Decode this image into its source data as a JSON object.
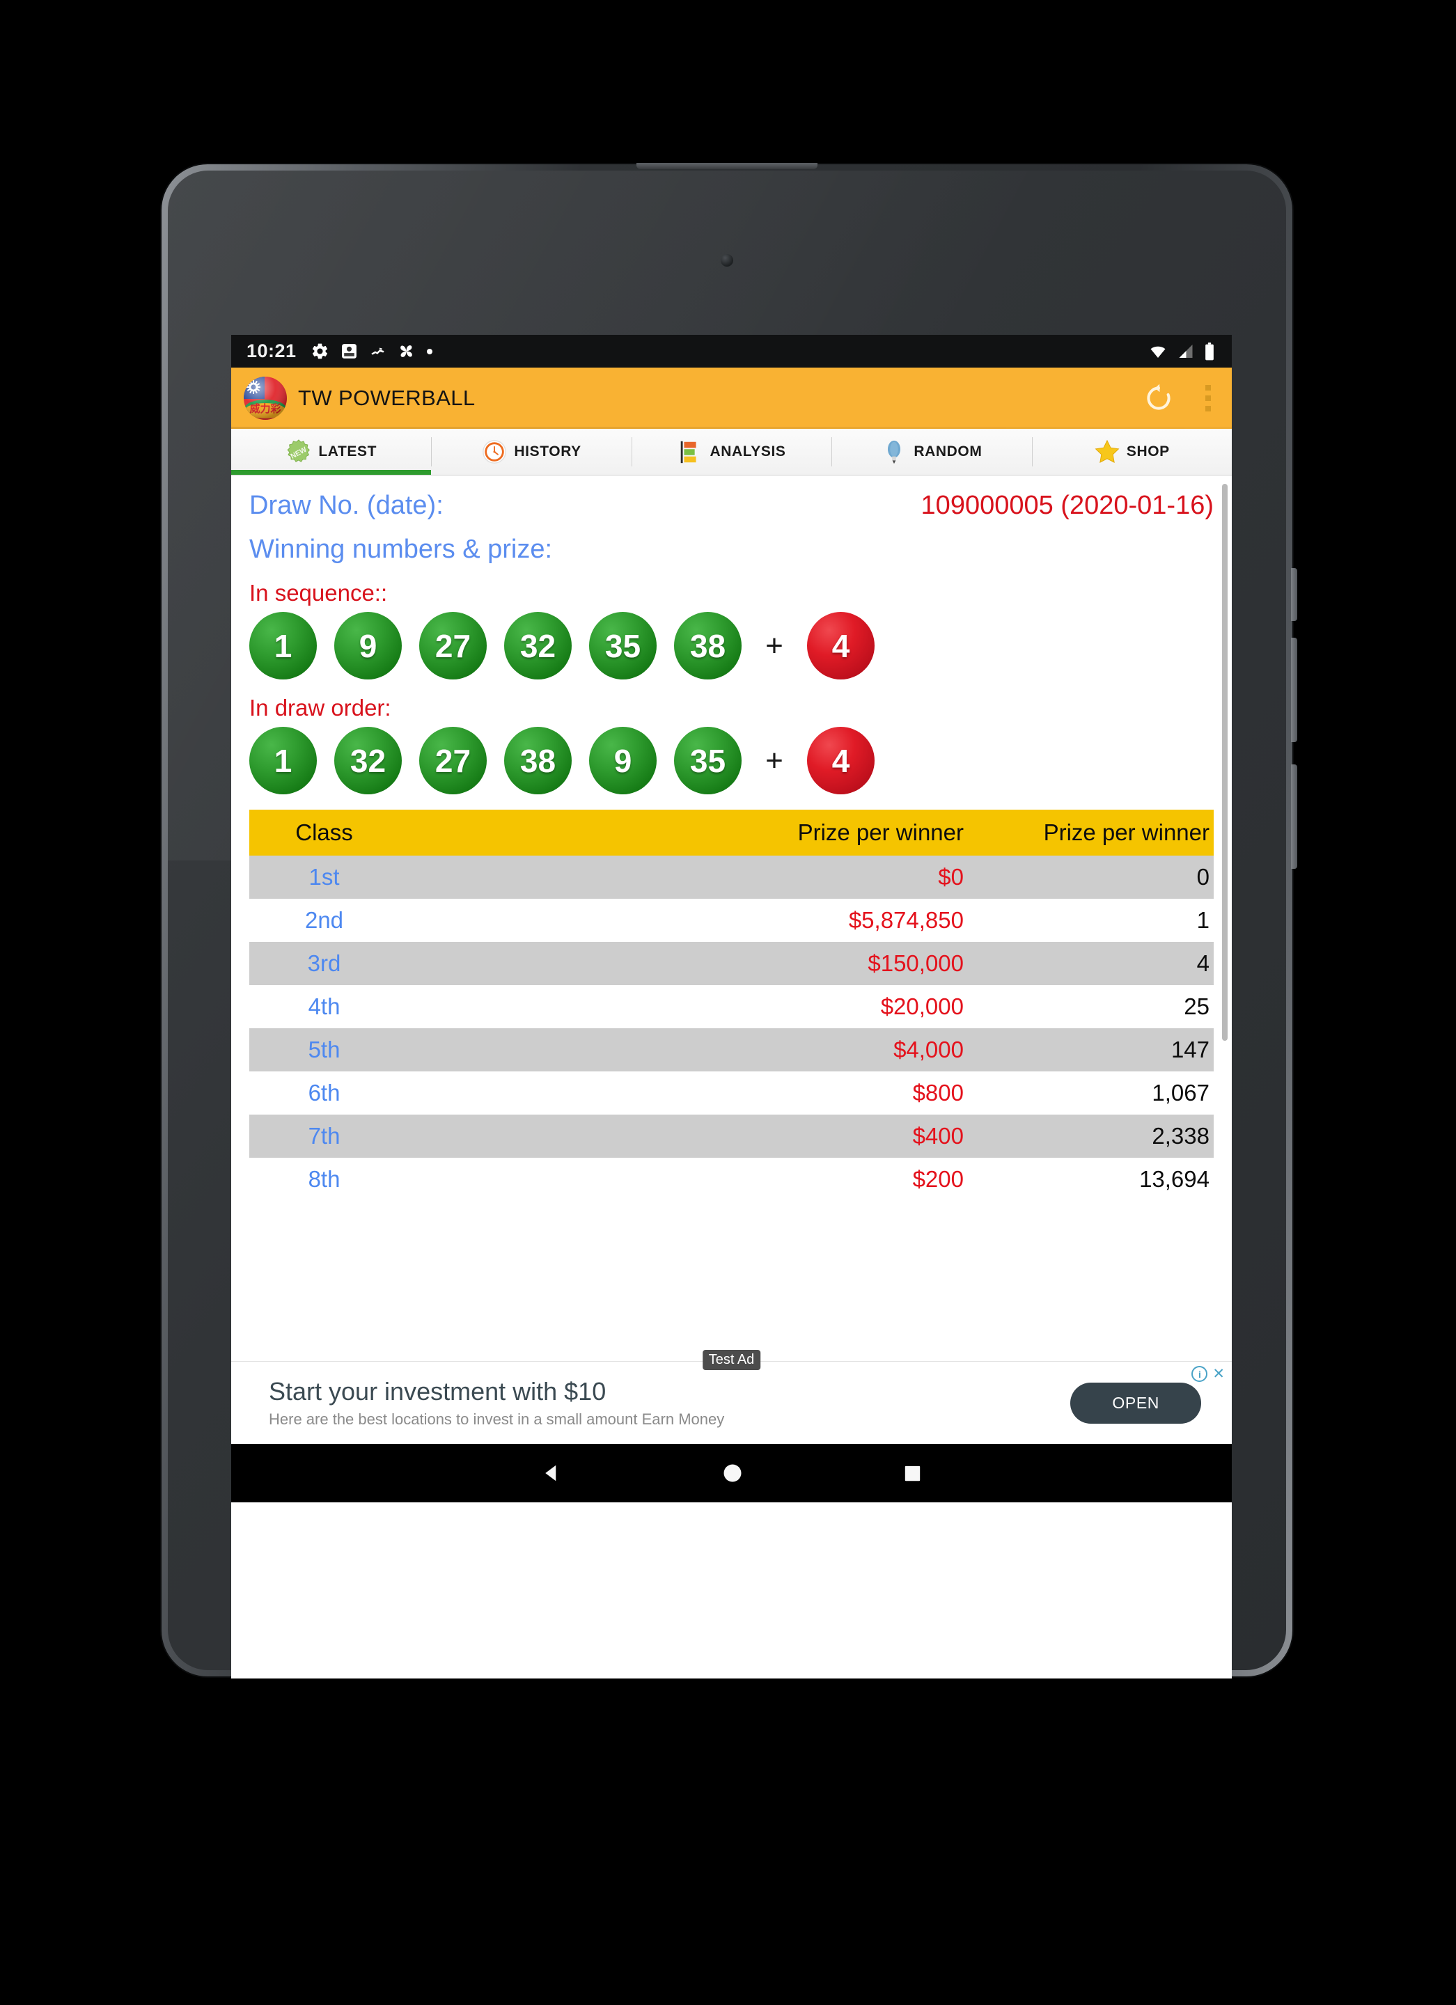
{
  "status_bar": {
    "time": "10:21",
    "left_icons": [
      "gear-icon",
      "app-notification-icon",
      "app-notification-icon-2",
      "pinwheel-icon",
      "dot-icon"
    ],
    "right_icons": [
      "wifi-icon",
      "cell-signal-icon",
      "battery-icon"
    ]
  },
  "app_bar": {
    "title": "TW POWERBALL",
    "logo_name": "tw-powerball-logo",
    "refresh_label": "refresh-icon",
    "overflow_label": "overflow-menu-icon",
    "background_color": "#F9B233"
  },
  "tabs": [
    {
      "label": "LATEST",
      "icon": "new-badge-icon",
      "active": true
    },
    {
      "label": "HISTORY",
      "icon": "clock-icon",
      "active": false
    },
    {
      "label": "ANALYSIS",
      "icon": "bar-chart-icon",
      "active": false
    },
    {
      "label": "RANDOM",
      "icon": "lightbulb-icon",
      "active": false
    },
    {
      "label": "SHOP",
      "icon": "star-icon",
      "active": false
    }
  ],
  "draw": {
    "draw_no_label": "Draw No. (date):",
    "draw_no_value": "109000005 (2020-01-16)",
    "winning_label": "Winning numbers & prize:",
    "in_sequence_label": "In sequence::",
    "in_draw_order_label": "In draw order:",
    "plus_symbol": "+",
    "in_sequence": {
      "main": [
        "1",
        "9",
        "27",
        "32",
        "35",
        "38"
      ],
      "bonus": "4"
    },
    "in_draw_order": {
      "main": [
        "1",
        "32",
        "27",
        "38",
        "9",
        "35"
      ],
      "bonus": "4"
    }
  },
  "prize_table": {
    "headers": [
      "Class",
      "Prize per winner",
      "Prize per winner"
    ],
    "rows": [
      {
        "class": "1st",
        "prize": "$0",
        "winners": "0"
      },
      {
        "class": "2nd",
        "prize": "$5,874,850",
        "winners": "1"
      },
      {
        "class": "3rd",
        "prize": "$150,000",
        "winners": "4"
      },
      {
        "class": "4th",
        "prize": "$20,000",
        "winners": "25"
      },
      {
        "class": "5th",
        "prize": "$4,000",
        "winners": "147"
      },
      {
        "class": "6th",
        "prize": "$800",
        "winners": "1,067"
      },
      {
        "class": "7th",
        "prize": "$400",
        "winners": "2,338"
      },
      {
        "class": "8th",
        "prize": "$200",
        "winners": "13,694"
      }
    ]
  },
  "ad": {
    "badge": "Test Ad",
    "title": "Start your investment with $10",
    "subtitle": "Here are the best locations to invest in a small amount Earn Money",
    "cta": "OPEN",
    "info_icon": "info-icon",
    "close_icon": "close-icon"
  },
  "nav_bar": {
    "back": "back-triangle-icon",
    "home": "home-circle-icon",
    "recents": "recents-square-icon"
  },
  "colors": {
    "accent": "#F9B233",
    "header_yellow": "#F5C400",
    "ball_green": "#1d8c1d",
    "ball_red": "#d6151f",
    "label_blue": "#5B8DEF",
    "value_red": "#D8121C"
  }
}
